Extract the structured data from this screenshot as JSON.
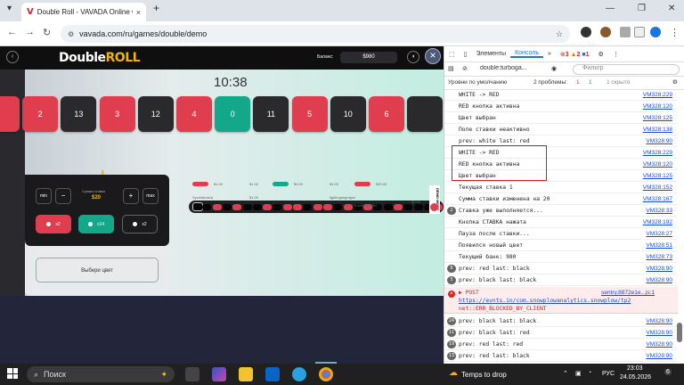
{
  "browser": {
    "tab_title": "Double Roll - VAVADA Online C",
    "tab_logo": "V",
    "new_tab": "+",
    "url": "vavada.com/ru/games/double/demo"
  },
  "game": {
    "logo_a": "Double",
    "logo_b": "ROLL",
    "balance_label": "Баланс:",
    "balance_value": "$980",
    "timer": "10:38",
    "tiles": [
      {
        "n": "",
        "c": "red"
      },
      {
        "n": "2",
        "c": "red"
      },
      {
        "n": "13",
        "c": "blk"
      },
      {
        "n": "3",
        "c": "red"
      },
      {
        "n": "12",
        "c": "blk"
      },
      {
        "n": "4",
        "c": "red"
      },
      {
        "n": "0",
        "c": "grn"
      },
      {
        "n": "11",
        "c": "blk"
      },
      {
        "n": "5",
        "c": "red"
      },
      {
        "n": "10",
        "c": "blk"
      },
      {
        "n": "6",
        "c": "red"
      },
      {
        "n": "",
        "c": "blk"
      }
    ],
    "history": [
      "blk",
      "blk",
      "red",
      "blk",
      "red",
      "blk",
      "blk",
      "red",
      "blk",
      "red",
      "red",
      "blk",
      "red",
      "red",
      "blk",
      "red",
      "blk",
      "red",
      "blk",
      "blk",
      "red",
      "blk",
      "blk",
      "blk",
      "red"
    ],
    "controls": {
      "min": "min",
      "minus": "−",
      "sum_label": "Сумма ставки",
      "sum_value": "$20",
      "plus": "+",
      "max": "max",
      "color_red": "x2",
      "color_green": "x14",
      "color_black": "x2",
      "pick": "Выбери цвет"
    },
    "bets": [
      {
        "amount": "$1.00",
        "user": "Syceldorland",
        "amount2": "$1.00"
      },
      {
        "amount": "$1.00",
        "user": "",
        "amount2": ""
      },
      {
        "amount": "$0.00",
        "user": "",
        "amount2": ""
      },
      {
        "amount": "$1.00",
        "user": "lightingbrightgim",
        "amount2": ""
      },
      {
        "amount": "$20.00",
        "user": "lt-lets_steel3d",
        "amount2": "$0.00"
      }
    ],
    "demo_label": "DEMO MODE"
  },
  "devtools": {
    "tab_elements": "Элементы",
    "tab_console": "Консоль",
    "errors": "3",
    "warnings": "2",
    "info": "1",
    "context": "double:turboga...",
    "filter": "Фильтр",
    "levels": "Уровни по умолчанию",
    "problems": "2 проблемы:",
    "p_err": "1",
    "p_info": "1",
    "hidden": "1 скрыто",
    "lines": [
      {
        "text": "WHITE -> RED",
        "ref": "VM328:229",
        "count": ""
      },
      {
        "text": "RED кнопка активна",
        "ref": "VM328:120",
        "count": ""
      },
      {
        "text": "Цвет выбран",
        "ref": "VM328:125",
        "count": ""
      },
      {
        "text": "Поле ставки неактивно",
        "ref": "VM328:138",
        "count": ""
      },
      {
        "text": "prev: white last: red",
        "ref": "VM328:90",
        "count": ""
      },
      {
        "text": "WHITE -> RED",
        "ref": "VM328:229",
        "count": ""
      },
      {
        "text": "RED кнопка активна",
        "ref": "VM328:120",
        "count": ""
      },
      {
        "text": "Цвет выбран",
        "ref": "VM328:125",
        "count": ""
      },
      {
        "text": "Текущая ставка 1",
        "ref": "VM328:152",
        "count": ""
      },
      {
        "text": "Сумма ставки изменена на 20",
        "ref": "VM328:167",
        "count": ""
      },
      {
        "text": "Ставка уже выполняется...",
        "ref": "VM328:33",
        "count": "2"
      },
      {
        "text": "Кнопка СТАВКА нажата",
        "ref": "VM328:192",
        "count": ""
      },
      {
        "text": "Пауза после ставки...",
        "ref": "VM328:27",
        "count": ""
      },
      {
        "text": "Появился новый цвет",
        "ref": "VM328:51",
        "count": ""
      },
      {
        "text": "Текущий банк: 980",
        "ref": "VM328:73",
        "count": ""
      },
      {
        "text": "prev: red last: black",
        "ref": "VM328:90",
        "count": "6"
      },
      {
        "text": "prev: black last: black",
        "ref": "VM328:90",
        "count": "5"
      }
    ],
    "error": {
      "title": "▶ POST",
      "ref": "sentry.8872e1e...js:1",
      "url": "https://evnts.in/com.snowplowanalytics.snowplow/tp2",
      "msg": "net::ERR_BLOCKED_BY_CLIENT"
    },
    "lines2": [
      {
        "text": "prev: black last: black",
        "ref": "VM328:90",
        "count": "24"
      },
      {
        "text": "prev: black last: red",
        "ref": "VM328:90",
        "count": "11"
      },
      {
        "text": "prev: red last: red",
        "ref": "VM328:90",
        "count": "19"
      },
      {
        "text": "prev: red last: black",
        "ref": "VM328:90",
        "count": "13"
      }
    ]
  },
  "taskbar": {
    "search": "Поиск",
    "weather": "Temps to drop",
    "lang": "РУС",
    "time": "23:03",
    "date": "24.05.2026",
    "notif": "6"
  },
  "colors": {
    "red": "#e03e4e",
    "black": "#2a2a2c",
    "green": "#14a88a",
    "accent": "#1a4bd6"
  }
}
